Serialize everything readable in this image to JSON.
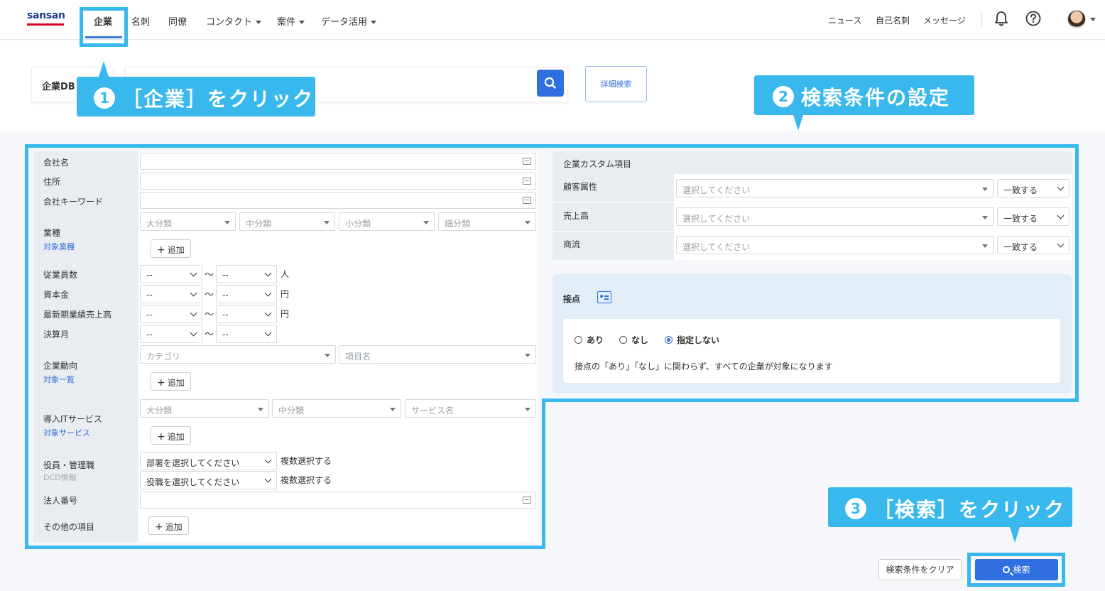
{
  "brand": {
    "logo": "sansan"
  },
  "nav": {
    "items": [
      {
        "label": "企業",
        "active": true
      },
      {
        "label": "名刺"
      },
      {
        "label": "同僚"
      },
      {
        "label": "コンタクト",
        "dropdown": true
      },
      {
        "label": "案件",
        "dropdown": true
      },
      {
        "label": "データ活用",
        "dropdown": true
      }
    ],
    "right": [
      "ニュース",
      "自己名刺",
      "メッセージ"
    ]
  },
  "search": {
    "db_tab": "企業DB",
    "advanced_label": "詳細検索"
  },
  "callouts": {
    "c1": {
      "num": "1",
      "text": "［企業］をクリック"
    },
    "c2": {
      "num": "2",
      "text": "検索条件の設定"
    },
    "c3": {
      "num": "3",
      "text": "［検索］をクリック"
    }
  },
  "form": {
    "company_name": "会社名",
    "address": "住所",
    "company_keyword": "会社キーワード",
    "industry": {
      "label": "業種",
      "sub": "対象業種",
      "selects": [
        "大分類",
        "中分類",
        "小分類",
        "細分類"
      ],
      "add": "追加"
    },
    "employees": {
      "label": "従業員数",
      "from": "--",
      "to": "--",
      "unit": "人"
    },
    "capital": {
      "label": "資本金",
      "from": "--",
      "to": "--",
      "unit": "円"
    },
    "latest_sales": {
      "label": "最新期業績売上高",
      "from": "--",
      "to": "--",
      "unit": "円"
    },
    "fiscal_month": {
      "label": "決算月",
      "from": "--",
      "to": "--"
    },
    "tilde": "〜",
    "trends": {
      "label": "企業動向",
      "sub": "対象一覧",
      "selects": [
        "カテゴリ",
        "項目名"
      ],
      "add": "追加"
    },
    "it_services": {
      "label": "導入ITサービス",
      "sub": "対象サービス",
      "selects": [
        "大分類",
        "中分類",
        "サービス名"
      ],
      "add": "追加"
    },
    "officers": {
      "label": "役員・管理職",
      "sub": "DCD情報",
      "dept_select": "部署を選択してください",
      "title_select": "役職を選択してください",
      "multi": "複数選択する"
    },
    "corp_number": "法人番号",
    "other": {
      "label": "その他の項目",
      "add": "追加"
    }
  },
  "custom": {
    "header": "企業カスタム項目",
    "rows": [
      {
        "label": "顧客属性",
        "placeholder": "選択してください",
        "match": "一致する"
      },
      {
        "label": "売上高",
        "placeholder": "選択してください",
        "match": "一致する"
      },
      {
        "label": "商流",
        "placeholder": "選択してください",
        "match": "一致する"
      }
    ]
  },
  "contact": {
    "title": "接点",
    "options": [
      "あり",
      "なし",
      "指定しない"
    ],
    "selected": "指定しない",
    "description": "接点の「あり」「なし」に関わらず、すべての企業が対象になります"
  },
  "actions": {
    "clear": "検索条件をクリア",
    "search": "検索"
  },
  "colors": {
    "accent": "#2f6fe0",
    "callout": "#38b8ec"
  }
}
